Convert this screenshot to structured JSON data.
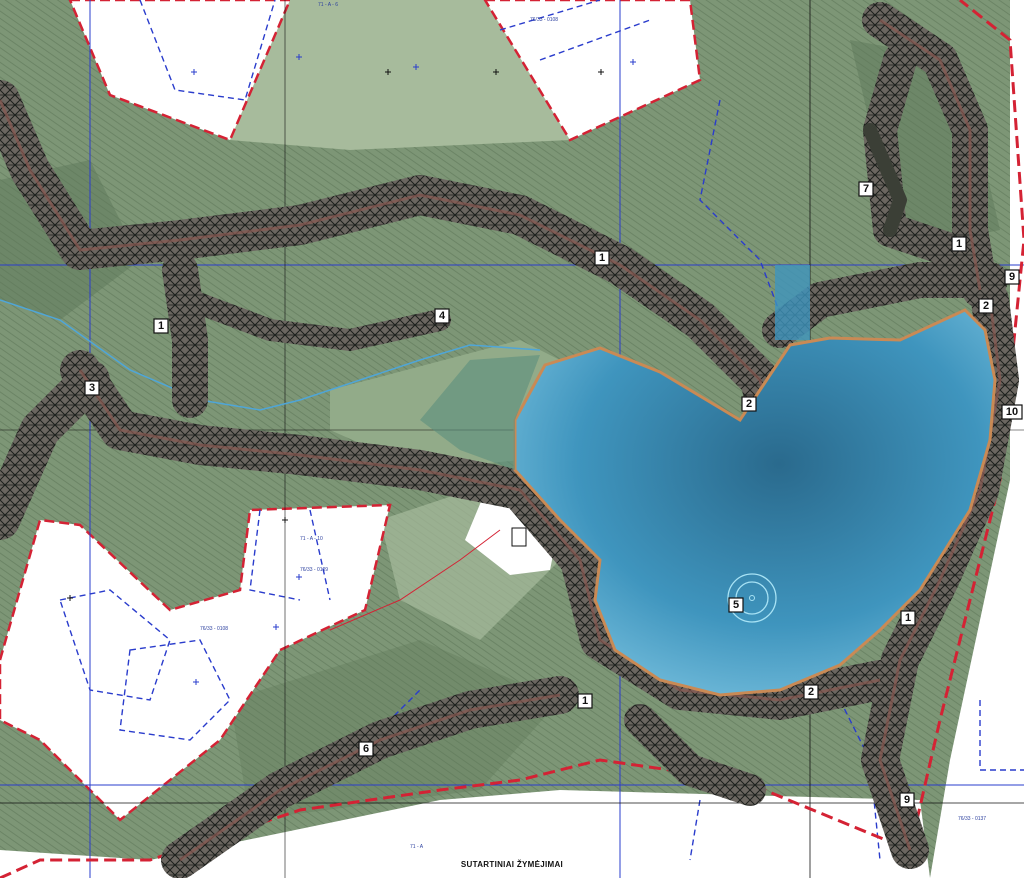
{
  "legend_title": "SUTARTINIAI ŽYMĖJIMAI",
  "colors": {
    "terrain": "#7d9676",
    "terrain_light": "#a7bb9c",
    "terrain_dark": "#5e775a",
    "water": "#3f95be",
    "water_light": "#7cc3e0",
    "boundary": "#d42234",
    "cadastre": "#2a3ccc",
    "grid": "#2a3ccc",
    "path": "#8a5a52",
    "hatch": "#1c1f1c",
    "shore": "#c98a55"
  },
  "labels": [
    {
      "id": "l1a",
      "text": "1"
    },
    {
      "id": "l1b",
      "text": "1"
    },
    {
      "id": "l1c",
      "text": "1"
    },
    {
      "id": "l1d",
      "text": "1"
    },
    {
      "id": "l1e",
      "text": "1"
    },
    {
      "id": "l2a",
      "text": "2"
    },
    {
      "id": "l2b",
      "text": "2"
    },
    {
      "id": "l2c",
      "text": "2"
    },
    {
      "id": "l3",
      "text": "3"
    },
    {
      "id": "l4",
      "text": "4"
    },
    {
      "id": "l5",
      "text": "5"
    },
    {
      "id": "l6",
      "text": "6"
    },
    {
      "id": "l7",
      "text": "7"
    },
    {
      "id": "l9a",
      "text": "9"
    },
    {
      "id": "l9b",
      "text": "9"
    },
    {
      "id": "l10",
      "text": "10"
    }
  ],
  "plot_codes": [
    "76/33 - 0108",
    "76/33 - 0109",
    "76/33 - 0108",
    "76/33 - 0137",
    "71 - A - 10",
    "71 - A - 6",
    "71 - A"
  ]
}
